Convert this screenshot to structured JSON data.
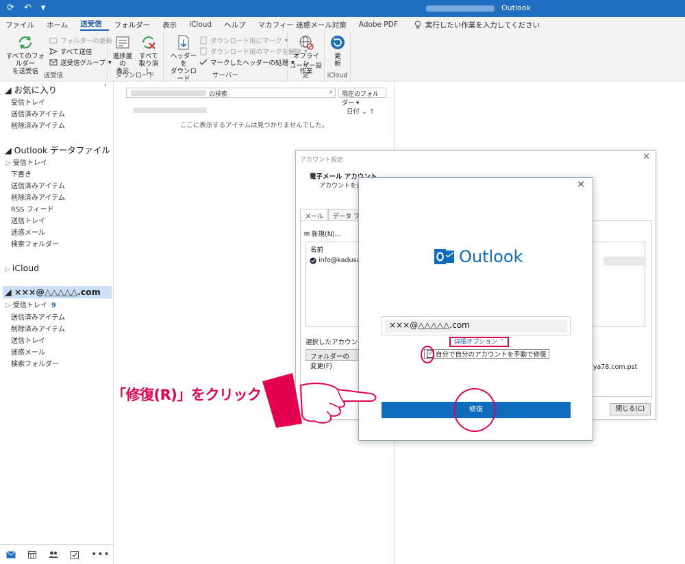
{
  "titlebar": {
    "app_title": "Outlook",
    "quick_access": [
      "⟳",
      "↶",
      "▾"
    ]
  },
  "tabs": [
    {
      "label": "ファイル"
    },
    {
      "label": "ホーム"
    },
    {
      "label": "送受信"
    },
    {
      "label": "フォルダー"
    },
    {
      "label": "表示"
    },
    {
      "label": "iCloud"
    },
    {
      "label": "ヘルプ"
    },
    {
      "label": "マカフィー 迷惑メール対策"
    },
    {
      "label": "Adobe PDF"
    }
  ],
  "tell_me": "実行したい作業を入力してください",
  "ribbon": {
    "send_receive_all": "すべてのフォルダー\nを送受信",
    "update_folder": "フォルダーの更新",
    "send_all": "すべて送信",
    "send_receive_groups": "送受信グループ",
    "group_send_receive": "送受信",
    "show_progress": "進捗度の\n表示",
    "cancel_all": "すべて\n取り消し",
    "group_download": "ダウンロード",
    "download_headers": "ヘッダーを\nダウンロード",
    "mark_to_download": "ダウンロード用にマーク",
    "unmark_to_download": "ダウンロード用のマークを解除",
    "process_marked_headers": "マークしたヘッダーの処理",
    "group_server": "サーバー",
    "work_offline": "オフライン\n作業",
    "group_preferences": "ユーザー設定",
    "refresh": "更\n新",
    "group_icloud": "iCloud"
  },
  "nav": {
    "favorites_header": "お気に入り",
    "favorites": [
      "受信トレイ",
      "送信済みアイテム",
      "削除済みアイテム"
    ],
    "datafile_header": "Outlook データファイル",
    "datafile_items": [
      "受信トレイ",
      "下書き",
      "送信済みアイテム",
      "削除済みアイテム",
      "RSS フィード",
      "送信トレイ",
      "迷惑メール",
      "検索フォルダー"
    ],
    "icloud_header": "iCloud",
    "account_header": "×××@△△△△△.com",
    "account_inbox": "受信トレイ",
    "account_inbox_count": "9",
    "account_items": [
      "送信済みアイテム",
      "削除済みアイテム",
      "送信トレイ",
      "迷惑メール",
      "検索フォルダー"
    ]
  },
  "listpane": {
    "search_suffix": "の検索",
    "scope": "現在のフォルダー",
    "sort": "日付 ⌄    ↑",
    "empty_message": "ここに表示するアイテムは見つかりませんでした。"
  },
  "account_dialog": {
    "title": "アカウント設定",
    "heading": "電子メール アカウント",
    "subheading": "アカウントを追加",
    "tab_mail": "メール",
    "tab_datafile": "データ ファイル",
    "new_button": "新規(N)...",
    "col_name": "名前",
    "account_row": "info@kadusay",
    "selected_info": "選択したアカウントでは",
    "change_folder": "フォルダーの変更(F)",
    "pst_path": "aya78.com.pst",
    "close_button": "閉じる(C)"
  },
  "outlook_dialog": {
    "logo_text": "Outlook",
    "email": "×××@△△△△△.com",
    "advanced_options": "詳細オプション ⌃",
    "manual_setup": "自分で自分のアカウントを手動で修復",
    "repair_button": "修復"
  },
  "annotation": {
    "text": "「修復(R)」をクリック"
  },
  "colors": {
    "accent": "#1e6fc1",
    "highlight": "#e5004f",
    "repair_button": "#0f6cbd"
  }
}
